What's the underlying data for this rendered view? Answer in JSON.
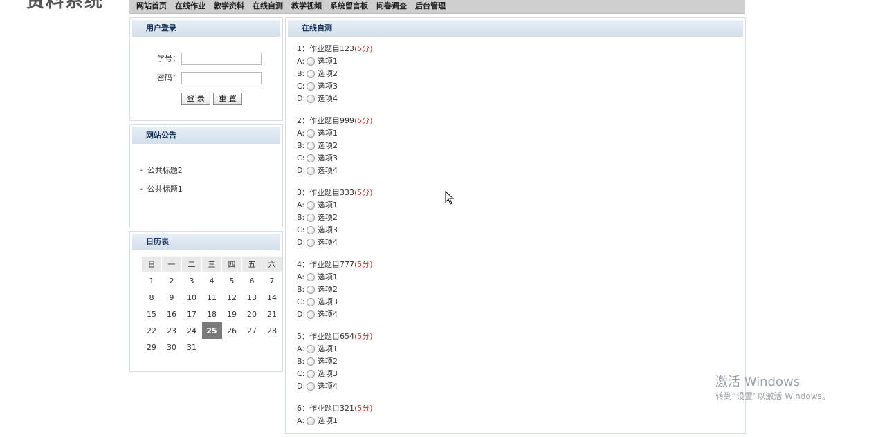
{
  "nav": {
    "items": [
      "网站首页",
      "在线作业",
      "教学资料",
      "在线自测",
      "教学视频",
      "系统留言板",
      "问卷调查",
      "后台管理"
    ]
  },
  "logo_fragment": "资料系统",
  "login": {
    "title": "用户登录",
    "student_id_label": "学号：",
    "password_label": "密码：",
    "login_button": "登 录",
    "reset_button": "重 置"
  },
  "notice": {
    "title": "网站公告",
    "items": [
      "公共标题2",
      "公共标题1"
    ]
  },
  "calendar": {
    "title": "日历表",
    "weekdays": [
      "日",
      "一",
      "二",
      "三",
      "四",
      "五",
      "六"
    ],
    "weeks": [
      [
        "1",
        "2",
        "3",
        "4",
        "5",
        "6",
        "7"
      ],
      [
        "8",
        "9",
        "10",
        "11",
        "12",
        "13",
        "14"
      ],
      [
        "15",
        "16",
        "17",
        "18",
        "19",
        "20",
        "21"
      ],
      [
        "22",
        "23",
        "24",
        "25",
        "26",
        "27",
        "28"
      ],
      [
        "29",
        "30",
        "31",
        "",
        "",
        "",
        ""
      ]
    ],
    "today": "25"
  },
  "quiz": {
    "title": "在线自测",
    "questions": [
      {
        "num": "1",
        "text": "作业题目123",
        "points": "(5分)",
        "options": [
          {
            "letter": "A:",
            "label": "选项1"
          },
          {
            "letter": "B:",
            "label": "选项2"
          },
          {
            "letter": "C:",
            "label": "选项3"
          },
          {
            "letter": "D:",
            "label": "选项4"
          }
        ]
      },
      {
        "num": "2",
        "text": "作业题目999",
        "points": "(5分)",
        "options": [
          {
            "letter": "A:",
            "label": "选项1"
          },
          {
            "letter": "B:",
            "label": "选项2"
          },
          {
            "letter": "C:",
            "label": "选项3"
          },
          {
            "letter": "D:",
            "label": "选项4"
          }
        ]
      },
      {
        "num": "3",
        "text": "作业题目333",
        "points": "(5分)",
        "options": [
          {
            "letter": "A:",
            "label": "选项1"
          },
          {
            "letter": "B:",
            "label": "选项2"
          },
          {
            "letter": "C:",
            "label": "选项3"
          },
          {
            "letter": "D:",
            "label": "选项4"
          }
        ]
      },
      {
        "num": "4",
        "text": "作业题目777",
        "points": "(5分)",
        "options": [
          {
            "letter": "A:",
            "label": "选项1"
          },
          {
            "letter": "B:",
            "label": "选项2"
          },
          {
            "letter": "C:",
            "label": "选项3"
          },
          {
            "letter": "D:",
            "label": "选项4"
          }
        ]
      },
      {
        "num": "5",
        "text": "作业题目654",
        "points": "(5分)",
        "options": [
          {
            "letter": "A:",
            "label": "选项1"
          },
          {
            "letter": "B:",
            "label": "选项2"
          },
          {
            "letter": "C:",
            "label": "选项3"
          },
          {
            "letter": "D:",
            "label": "选项4"
          }
        ]
      },
      {
        "num": "6",
        "text": "作业题目321",
        "points": "(5分)",
        "options": [
          {
            "letter": "A:",
            "label": "选项1"
          }
        ]
      }
    ]
  },
  "watermark": {
    "line1": "激活 Windows",
    "line2": "转到“设置”以激活 Windows。"
  },
  "colors": {
    "nav_bg": "#cfcfcf",
    "panel_head_text": "#14335c",
    "points_red": "#c0392b",
    "today_bg": "#7a7a7a"
  }
}
